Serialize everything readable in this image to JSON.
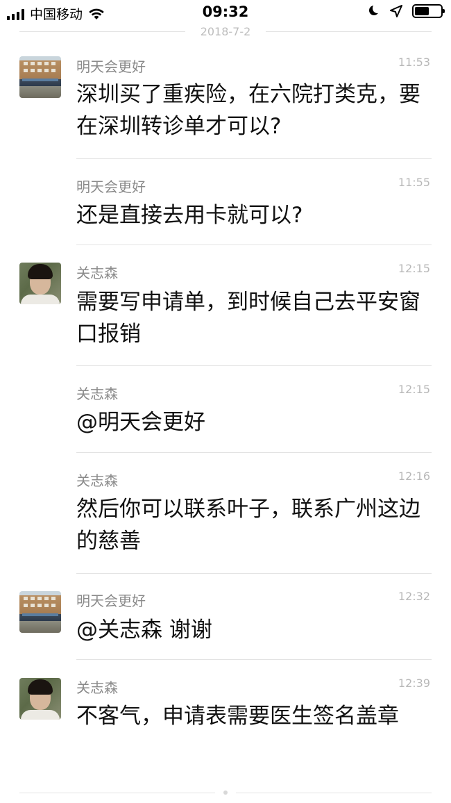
{
  "status_bar": {
    "carrier": "中国移动",
    "time": "09:32",
    "icons": [
      "signal-icon",
      "wifi-icon",
      "moon-icon",
      "location-icon",
      "battery-icon"
    ],
    "battery_level": 0.55
  },
  "date_separator": "2018-7-2",
  "messages": [
    {
      "sender": "明天会更好",
      "time": "11:53",
      "text": "深圳买了重疾险，在六院打类克，要在深圳转诊单才可以?",
      "avatar": "building"
    },
    {
      "sender": "明天会更好",
      "time": "11:55",
      "text": "还是直接去用卡就可以?",
      "avatar": ""
    },
    {
      "sender": "关志森",
      "time": "12:15",
      "text": "需要写申请单，到时候自己去平安窗口报销",
      "avatar": "person"
    },
    {
      "sender": "关志森",
      "time": "12:15",
      "text": "@明天会更好",
      "avatar": ""
    },
    {
      "sender": "关志森",
      "time": "12:16",
      "text": "然后你可以联系叶子，联系广州这边的慈善",
      "avatar": ""
    },
    {
      "sender": "明天会更好",
      "time": "12:32",
      "text": "@关志森 谢谢",
      "avatar": "building"
    },
    {
      "sender": "关志森",
      "time": "12:39",
      "text": "不客气，申请表需要医生签名盖章",
      "avatar": "person"
    }
  ]
}
